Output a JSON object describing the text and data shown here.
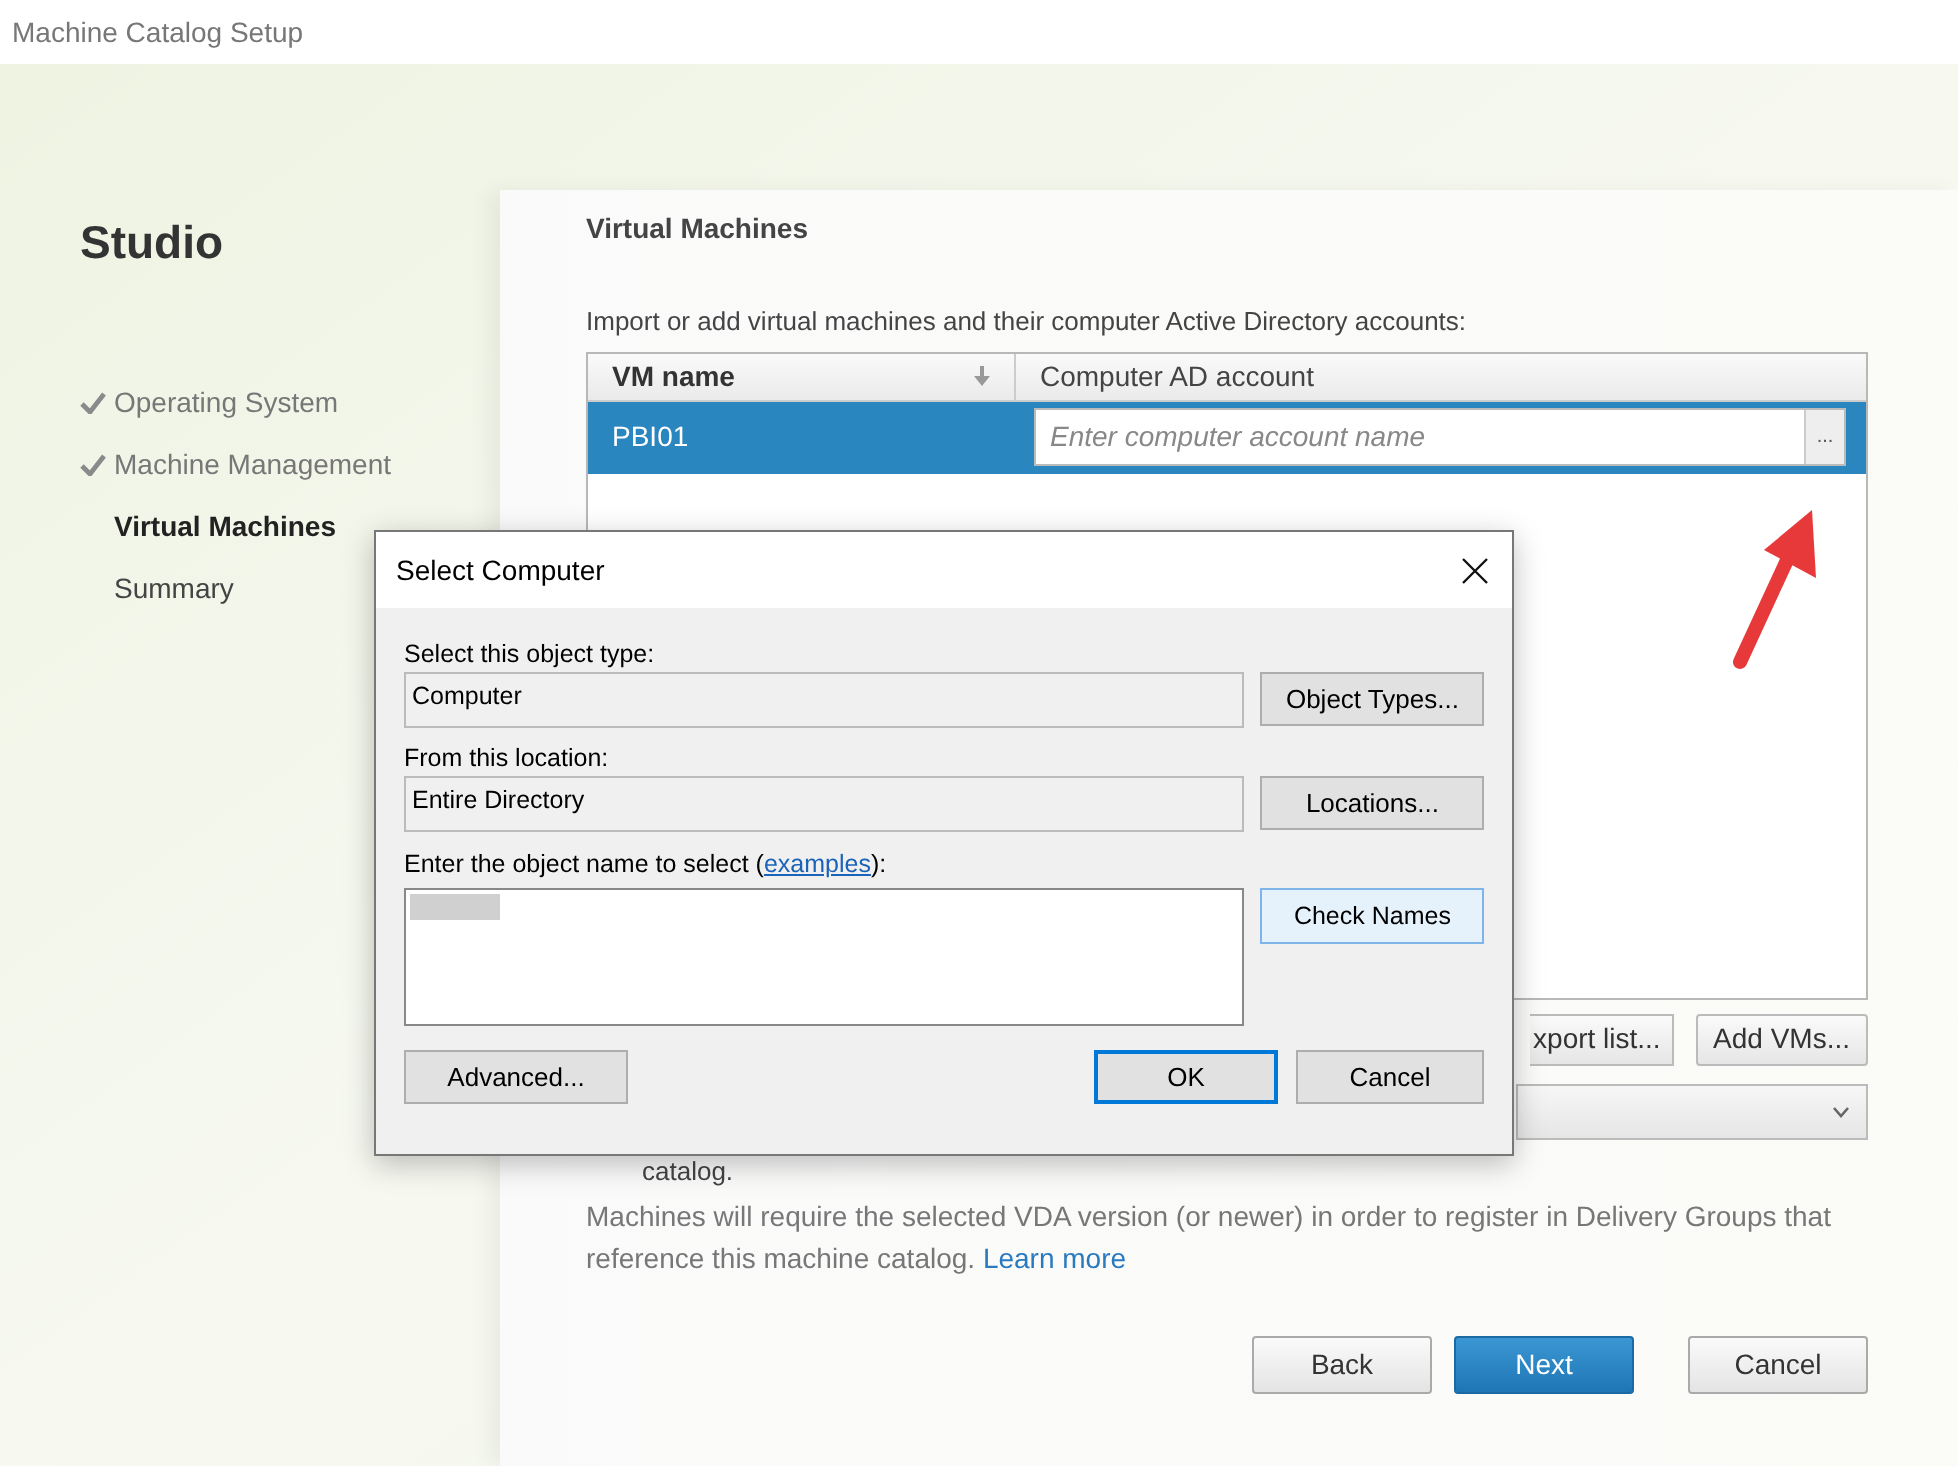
{
  "window": {
    "title": "Machine Catalog Setup"
  },
  "sidebar": {
    "title": "Studio",
    "steps": [
      {
        "label": "Operating System",
        "completed": true,
        "selected": false
      },
      {
        "label": "Machine Management",
        "completed": true,
        "selected": false
      },
      {
        "label": "Virtual Machines",
        "completed": false,
        "selected": true
      },
      {
        "label": "Summary",
        "completed": false,
        "selected": false
      }
    ]
  },
  "page": {
    "heading": "Virtual Machines",
    "intro": "Import or add virtual machines and their computer Active Directory accounts:",
    "table": {
      "columns": [
        {
          "label": "VM name",
          "sorted": true
        },
        {
          "label": "Computer AD account",
          "sorted": false
        }
      ],
      "rows": [
        {
          "vm_name": "PBI01",
          "account_placeholder": "Enter computer account name",
          "browse_label": "...",
          "selected": true
        }
      ]
    },
    "list_buttons": [
      "xport list...",
      "Add VMs..."
    ],
    "partial_text": "catalog.",
    "note": "Machines will require the selected VDA version (or newer) in order to register in Delivery Groups that reference this machine catalog.",
    "note_link": "Learn more",
    "nav_buttons": [
      {
        "label": "Back",
        "primary": false
      },
      {
        "label": "Next",
        "primary": true
      },
      {
        "label": "Cancel",
        "primary": false
      }
    ]
  },
  "dialog": {
    "title": "Select Computer",
    "fields": [
      {
        "label": "Select this object type:",
        "value": "Computer",
        "button": "Object Types..."
      },
      {
        "label": "From this location:",
        "value": "Entire Directory",
        "button": "Locations..."
      }
    ],
    "name_label_before": "Enter the object name to select (",
    "name_link": "examples",
    "name_label_after": "):",
    "check_button": "Check Names",
    "advanced_button": "Advanced...",
    "ok_button": "OK",
    "cancel_button": "Cancel"
  }
}
